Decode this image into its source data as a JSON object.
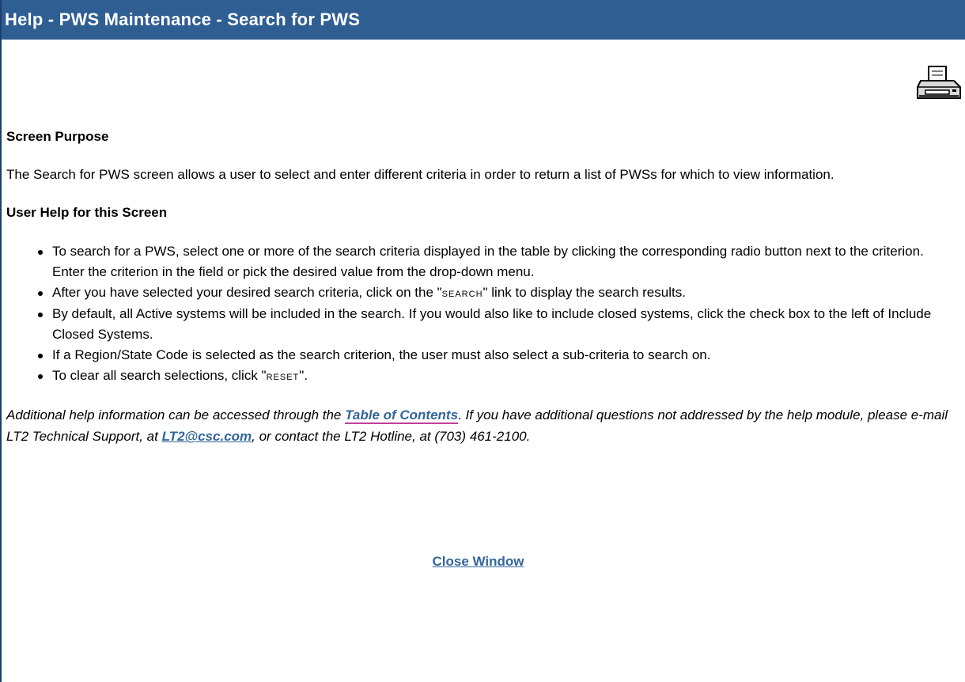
{
  "header": {
    "title": "Help - PWS Maintenance - Search for PWS"
  },
  "toolbar": {
    "print_icon": "printer-icon"
  },
  "purpose": {
    "heading": "Screen Purpose",
    "text": "The Search for PWS screen allows a user to select and enter different criteria in order to return a list of PWSs for which to view information."
  },
  "user_help": {
    "heading": "User Help for this Screen",
    "items": {
      "0": "To search for a PWS, select one or more of the search criteria displayed in the table by clicking the corresponding radio button next to the criterion. Enter the criterion in the field or pick the desired value from the drop-down menu.",
      "1_before": "After you have selected your desired search criteria, click on the \"",
      "1_keyword": "SEARCH",
      "1_after": "\" link to display the search results.",
      "2": "By default, all Active systems will be included in the search. If you would also like to include closed systems, click the check box to the left of Include Closed Systems.",
      "3": "If a Region/State Code is selected as the search criterion, the user must also select a sub-criteria to search on.",
      "4_before": "To clear all search selections, click \"",
      "4_keyword": "RESET",
      "4_after": "\"."
    }
  },
  "additional": {
    "part1": "Additional help information can be accessed through the ",
    "toc_link": "Table of Contents",
    "part2": ". If you have additional questions not addressed by the help module, please e-mail LT2 Technical Support, at ",
    "email_link": "LT2@csc.com",
    "part3": ", or contact the LT2 Hotline, at (703) 461-2100."
  },
  "footer": {
    "close_label": "Close Window"
  },
  "colors": {
    "titlebar": "#2f5e93",
    "link": "#336699"
  }
}
